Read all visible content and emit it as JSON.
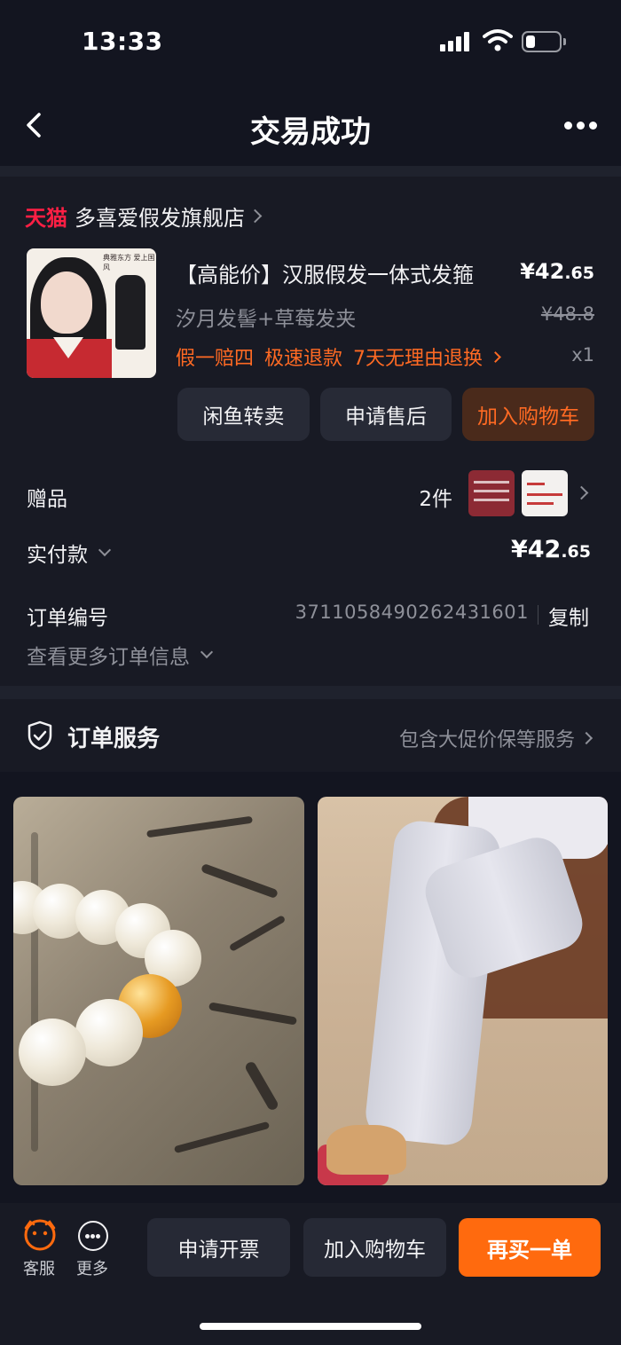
{
  "status_bar": {
    "time": "13:33"
  },
  "nav": {
    "title": "交易成功"
  },
  "shop": {
    "brand": "天猫",
    "name": "多喜爱假发旗舰店"
  },
  "product": {
    "title": "【高能价】汉服假发一体式发箍",
    "price_int": "¥42",
    "price_dec": ".65",
    "sku": "汐月发髻+草莓发夹",
    "original_price": "¥48.8",
    "tags": [
      "假一赔四",
      "极速退款",
      "7天无理由退换"
    ],
    "quantity": "x1",
    "thumb_text": "典雅东方  爱上国风"
  },
  "actions": {
    "resell": "闲鱼转卖",
    "after_sale": "申请售后",
    "add_cart": "加入购物车"
  },
  "gifts": {
    "label": "赠品",
    "count": "2件"
  },
  "payment": {
    "label": "实付款",
    "amount_int": "¥42",
    "amount_dec": ".65"
  },
  "order": {
    "label": "订单编号",
    "number": "3711058490262431601",
    "copy": "复制",
    "more_info": "查看更多订单信息"
  },
  "service": {
    "title": "订单服务",
    "summary": "包含大促价保等服务"
  },
  "bottom": {
    "customer_service": "客服",
    "more": "更多",
    "invoice": "申请开票",
    "add_cart": "加入购物车",
    "buy_again": "再买一单"
  },
  "colors": {
    "accent": "#ff6a0e",
    "tmall_red": "#ff1f44",
    "background": "#131520"
  }
}
